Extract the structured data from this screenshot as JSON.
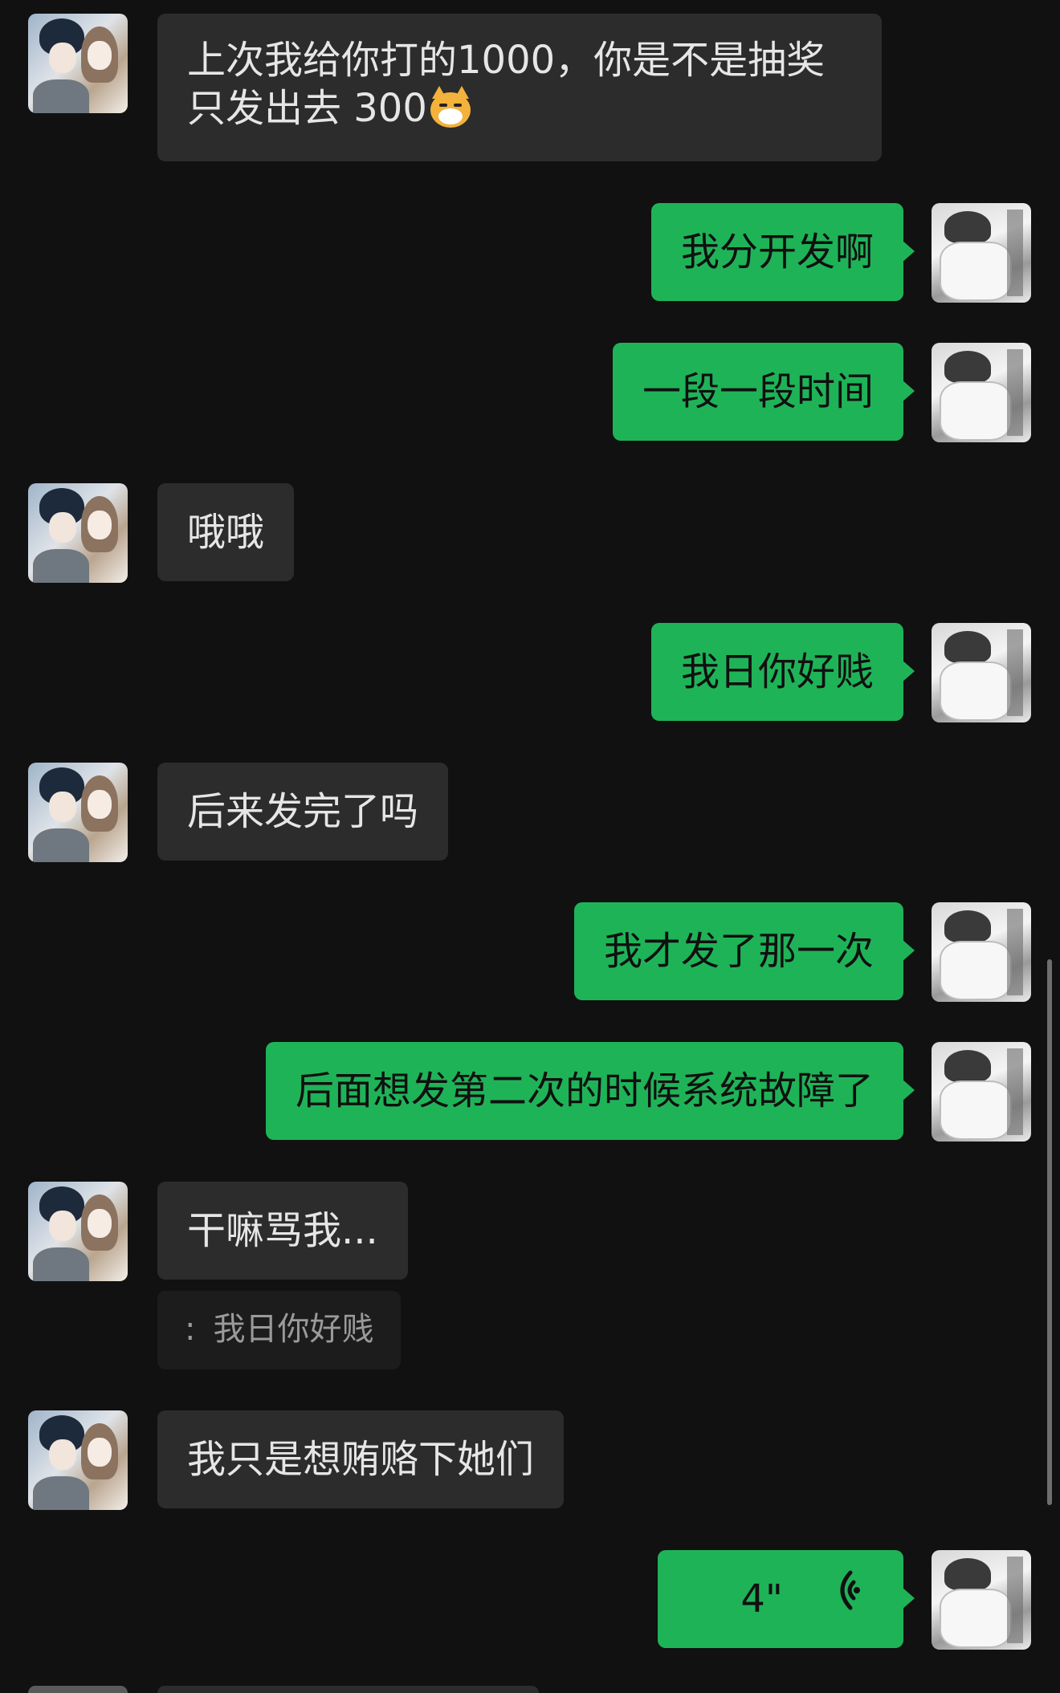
{
  "messages": [
    {
      "side": "in",
      "lines": [
        "上次我给你打的1000，你是不是抽奖",
        "只发出去 300"
      ],
      "emoji": "cat-face"
    },
    {
      "side": "out",
      "text": "我分开发啊"
    },
    {
      "side": "out",
      "text": "一段一段时间"
    },
    {
      "side": "in",
      "text": "哦哦"
    },
    {
      "side": "out",
      "text": "我日你好贱"
    },
    {
      "side": "in",
      "text": "后来发完了吗"
    },
    {
      "side": "out",
      "text": "我才发了那一次"
    },
    {
      "side": "out",
      "text": "后面想发第二次的时候系统故障了"
    },
    {
      "side": "in",
      "text": "干嘛骂我..."
    },
    {
      "quote_colon": ":",
      "quote_text": "我日你好贱"
    },
    {
      "side": "in",
      "text": "我只是想贿赂下她们"
    },
    {
      "side": "out",
      "voice_length": "4\"",
      "icon": "voice-wave-icon"
    }
  ],
  "colors": {
    "background": "#111111",
    "incoming_bubble": "#2c2c2c",
    "outgoing_bubble": "#1fb358",
    "quote_bubble": "#1c1c1c"
  }
}
